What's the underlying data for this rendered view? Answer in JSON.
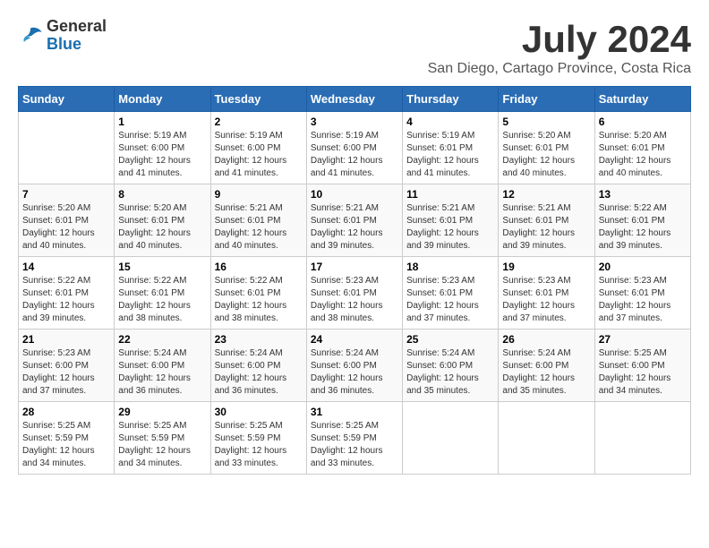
{
  "logo": {
    "general": "General",
    "blue": "Blue"
  },
  "title": "July 2024",
  "subtitle": "San Diego, Cartago Province, Costa Rica",
  "days_header": [
    "Sunday",
    "Monday",
    "Tuesday",
    "Wednesday",
    "Thursday",
    "Friday",
    "Saturday"
  ],
  "weeks": [
    [
      {
        "day": "",
        "sunrise": "",
        "sunset": "",
        "daylight": ""
      },
      {
        "day": "1",
        "sunrise": "Sunrise: 5:19 AM",
        "sunset": "Sunset: 6:00 PM",
        "daylight": "Daylight: 12 hours and 41 minutes."
      },
      {
        "day": "2",
        "sunrise": "Sunrise: 5:19 AM",
        "sunset": "Sunset: 6:00 PM",
        "daylight": "Daylight: 12 hours and 41 minutes."
      },
      {
        "day": "3",
        "sunrise": "Sunrise: 5:19 AM",
        "sunset": "Sunset: 6:00 PM",
        "daylight": "Daylight: 12 hours and 41 minutes."
      },
      {
        "day": "4",
        "sunrise": "Sunrise: 5:19 AM",
        "sunset": "Sunset: 6:01 PM",
        "daylight": "Daylight: 12 hours and 41 minutes."
      },
      {
        "day": "5",
        "sunrise": "Sunrise: 5:20 AM",
        "sunset": "Sunset: 6:01 PM",
        "daylight": "Daylight: 12 hours and 40 minutes."
      },
      {
        "day": "6",
        "sunrise": "Sunrise: 5:20 AM",
        "sunset": "Sunset: 6:01 PM",
        "daylight": "Daylight: 12 hours and 40 minutes."
      }
    ],
    [
      {
        "day": "7",
        "sunrise": "Sunrise: 5:20 AM",
        "sunset": "Sunset: 6:01 PM",
        "daylight": "Daylight: 12 hours and 40 minutes."
      },
      {
        "day": "8",
        "sunrise": "Sunrise: 5:20 AM",
        "sunset": "Sunset: 6:01 PM",
        "daylight": "Daylight: 12 hours and 40 minutes."
      },
      {
        "day": "9",
        "sunrise": "Sunrise: 5:21 AM",
        "sunset": "Sunset: 6:01 PM",
        "daylight": "Daylight: 12 hours and 40 minutes."
      },
      {
        "day": "10",
        "sunrise": "Sunrise: 5:21 AM",
        "sunset": "Sunset: 6:01 PM",
        "daylight": "Daylight: 12 hours and 39 minutes."
      },
      {
        "day": "11",
        "sunrise": "Sunrise: 5:21 AM",
        "sunset": "Sunset: 6:01 PM",
        "daylight": "Daylight: 12 hours and 39 minutes."
      },
      {
        "day": "12",
        "sunrise": "Sunrise: 5:21 AM",
        "sunset": "Sunset: 6:01 PM",
        "daylight": "Daylight: 12 hours and 39 minutes."
      },
      {
        "day": "13",
        "sunrise": "Sunrise: 5:22 AM",
        "sunset": "Sunset: 6:01 PM",
        "daylight": "Daylight: 12 hours and 39 minutes."
      }
    ],
    [
      {
        "day": "14",
        "sunrise": "Sunrise: 5:22 AM",
        "sunset": "Sunset: 6:01 PM",
        "daylight": "Daylight: 12 hours and 39 minutes."
      },
      {
        "day": "15",
        "sunrise": "Sunrise: 5:22 AM",
        "sunset": "Sunset: 6:01 PM",
        "daylight": "Daylight: 12 hours and 38 minutes."
      },
      {
        "day": "16",
        "sunrise": "Sunrise: 5:22 AM",
        "sunset": "Sunset: 6:01 PM",
        "daylight": "Daylight: 12 hours and 38 minutes."
      },
      {
        "day": "17",
        "sunrise": "Sunrise: 5:23 AM",
        "sunset": "Sunset: 6:01 PM",
        "daylight": "Daylight: 12 hours and 38 minutes."
      },
      {
        "day": "18",
        "sunrise": "Sunrise: 5:23 AM",
        "sunset": "Sunset: 6:01 PM",
        "daylight": "Daylight: 12 hours and 37 minutes."
      },
      {
        "day": "19",
        "sunrise": "Sunrise: 5:23 AM",
        "sunset": "Sunset: 6:01 PM",
        "daylight": "Daylight: 12 hours and 37 minutes."
      },
      {
        "day": "20",
        "sunrise": "Sunrise: 5:23 AM",
        "sunset": "Sunset: 6:01 PM",
        "daylight": "Daylight: 12 hours and 37 minutes."
      }
    ],
    [
      {
        "day": "21",
        "sunrise": "Sunrise: 5:23 AM",
        "sunset": "Sunset: 6:00 PM",
        "daylight": "Daylight: 12 hours and 37 minutes."
      },
      {
        "day": "22",
        "sunrise": "Sunrise: 5:24 AM",
        "sunset": "Sunset: 6:00 PM",
        "daylight": "Daylight: 12 hours and 36 minutes."
      },
      {
        "day": "23",
        "sunrise": "Sunrise: 5:24 AM",
        "sunset": "Sunset: 6:00 PM",
        "daylight": "Daylight: 12 hours and 36 minutes."
      },
      {
        "day": "24",
        "sunrise": "Sunrise: 5:24 AM",
        "sunset": "Sunset: 6:00 PM",
        "daylight": "Daylight: 12 hours and 36 minutes."
      },
      {
        "day": "25",
        "sunrise": "Sunrise: 5:24 AM",
        "sunset": "Sunset: 6:00 PM",
        "daylight": "Daylight: 12 hours and 35 minutes."
      },
      {
        "day": "26",
        "sunrise": "Sunrise: 5:24 AM",
        "sunset": "Sunset: 6:00 PM",
        "daylight": "Daylight: 12 hours and 35 minutes."
      },
      {
        "day": "27",
        "sunrise": "Sunrise: 5:25 AM",
        "sunset": "Sunset: 6:00 PM",
        "daylight": "Daylight: 12 hours and 34 minutes."
      }
    ],
    [
      {
        "day": "28",
        "sunrise": "Sunrise: 5:25 AM",
        "sunset": "Sunset: 5:59 PM",
        "daylight": "Daylight: 12 hours and 34 minutes."
      },
      {
        "day": "29",
        "sunrise": "Sunrise: 5:25 AM",
        "sunset": "Sunset: 5:59 PM",
        "daylight": "Daylight: 12 hours and 34 minutes."
      },
      {
        "day": "30",
        "sunrise": "Sunrise: 5:25 AM",
        "sunset": "Sunset: 5:59 PM",
        "daylight": "Daylight: 12 hours and 33 minutes."
      },
      {
        "day": "31",
        "sunrise": "Sunrise: 5:25 AM",
        "sunset": "Sunset: 5:59 PM",
        "daylight": "Daylight: 12 hours and 33 minutes."
      },
      {
        "day": "",
        "sunrise": "",
        "sunset": "",
        "daylight": ""
      },
      {
        "day": "",
        "sunrise": "",
        "sunset": "",
        "daylight": ""
      },
      {
        "day": "",
        "sunrise": "",
        "sunset": "",
        "daylight": ""
      }
    ]
  ]
}
